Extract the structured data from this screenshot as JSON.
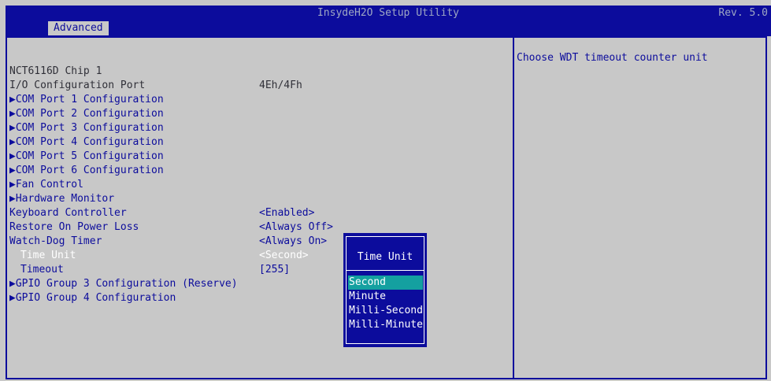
{
  "header": {
    "title": "InsydeH2O Setup Utility",
    "revision": "Rev. 5.0"
  },
  "tabs": [
    {
      "label": "Advanced"
    }
  ],
  "help_text": "Choose WDT timeout counter unit",
  "items": [
    {
      "label": "NCT6116D Chip 1",
      "value": ""
    },
    {
      "label": "I/O Configuration Port",
      "value": "4Eh/4Fh"
    },
    {
      "label": "▶COM Port 1 Configuration",
      "value": ""
    },
    {
      "label": "▶COM Port 2 Configuration",
      "value": ""
    },
    {
      "label": "▶COM Port 3 Configuration",
      "value": ""
    },
    {
      "label": "▶COM Port 4 Configuration",
      "value": ""
    },
    {
      "label": "▶COM Port 5 Configuration",
      "value": ""
    },
    {
      "label": "▶COM Port 6 Configuration",
      "value": ""
    },
    {
      "label": "▶Fan Control",
      "value": ""
    },
    {
      "label": "▶Hardware Monitor",
      "value": ""
    },
    {
      "label": "Keyboard Controller",
      "value": "<Enabled>"
    },
    {
      "label": "Restore On Power Loss",
      "value": "<Always Off>"
    },
    {
      "label": "Watch-Dog Timer",
      "value": "<Always On>"
    },
    {
      "label": "Time Unit",
      "value": "<Second>"
    },
    {
      "label": "Timeout",
      "value": "[255]"
    },
    {
      "label": "▶GPIO Group 3 Configuration (Reserve)",
      "value": ""
    },
    {
      "label": "▶GPIO Group 4 Configuration",
      "value": ""
    }
  ],
  "popup": {
    "title": "Time Unit",
    "options": [
      "Second",
      "Minute",
      "Milli-Second",
      "Milli-Minute"
    ],
    "selected": "Second"
  },
  "colors": {
    "blue": "#0c0c9c",
    "gray": "#c8c8c8",
    "highlight": "#14a0a0"
  },
  "icons": {
    "mouse_pointer": "arrow-cursor-icon"
  }
}
